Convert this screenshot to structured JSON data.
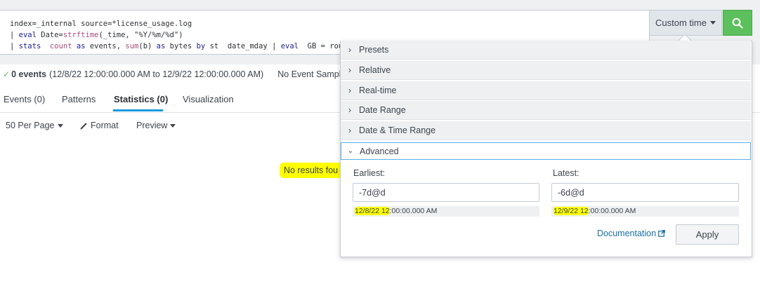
{
  "search": {
    "query_line1": "index=_internal source=*license_usage.log",
    "query_line2_pipe": "| ",
    "query_line2_cmd": "eval",
    "query_line2_a": " Date=",
    "query_line2_fn": "strftime",
    "query_line2_b": "(_time, \"%Y/%m/%d\")",
    "query_line3_pipe": "| ",
    "query_line3_cmd": "stats",
    "query_line3_sp": "  ",
    "query_line3_fn1": "count",
    "query_line3_as1": " as ",
    "query_line3_c": "events, ",
    "query_line3_fn2": "sum",
    "query_line3_d": "(b) ",
    "query_line3_as2": "as",
    "query_line3_e": " bytes ",
    "query_line3_by": "by",
    "query_line3_f": " st  date_mday ",
    "query_line3_pipe2": "| ",
    "query_line3_cmd2": "eval",
    "query_line3_g": "  GB = rou",
    "time_picker_label": "Custom time"
  },
  "status": {
    "events": "0 events",
    "range": "(12/8/22 12:00:00.000 AM to 12/9/22 12:00:00.000 AM)",
    "sampling": "No Event Sampli"
  },
  "tabs": [
    {
      "label": "Events (0)"
    },
    {
      "label": "Patterns"
    },
    {
      "label": "Statistics (0)",
      "active": true
    },
    {
      "label": "Visualization"
    }
  ],
  "toolbar": {
    "per_page": "50 Per Page",
    "format": "Format",
    "preview": "Preview"
  },
  "results": {
    "message": "No results fou"
  },
  "time_dropdown": {
    "sections": [
      {
        "label": "Presets",
        "icon": "chevron-right-icon"
      },
      {
        "label": "Relative",
        "icon": "chevron-right-icon"
      },
      {
        "label": "Real-time",
        "icon": "chevron-right-icon"
      },
      {
        "label": "Date Range",
        "icon": "chevron-right-icon"
      },
      {
        "label": "Date & Time Range",
        "icon": "chevron-right-icon"
      },
      {
        "label": "Advanced",
        "icon": "chevron-down-icon",
        "open": true
      }
    ],
    "advanced": {
      "earliest_label": "Earliest:",
      "earliest_value": "-7d@d",
      "earliest_hint_hl": "12/8/22 12",
      "earliest_hint_rest": ":00:00.000 AM",
      "latest_label": "Latest:",
      "latest_value": "-6d@d",
      "latest_hint_hl": "12/9/22 12",
      "latest_hint_rest": ":00:00.000 AM",
      "documentation_label": "Documentation",
      "apply_label": "Apply"
    }
  },
  "colors": {
    "search_button": "#5cc05c",
    "highlight": "#ffff00",
    "active_tab": "#1a9ae0",
    "link": "#1a6fa8"
  }
}
